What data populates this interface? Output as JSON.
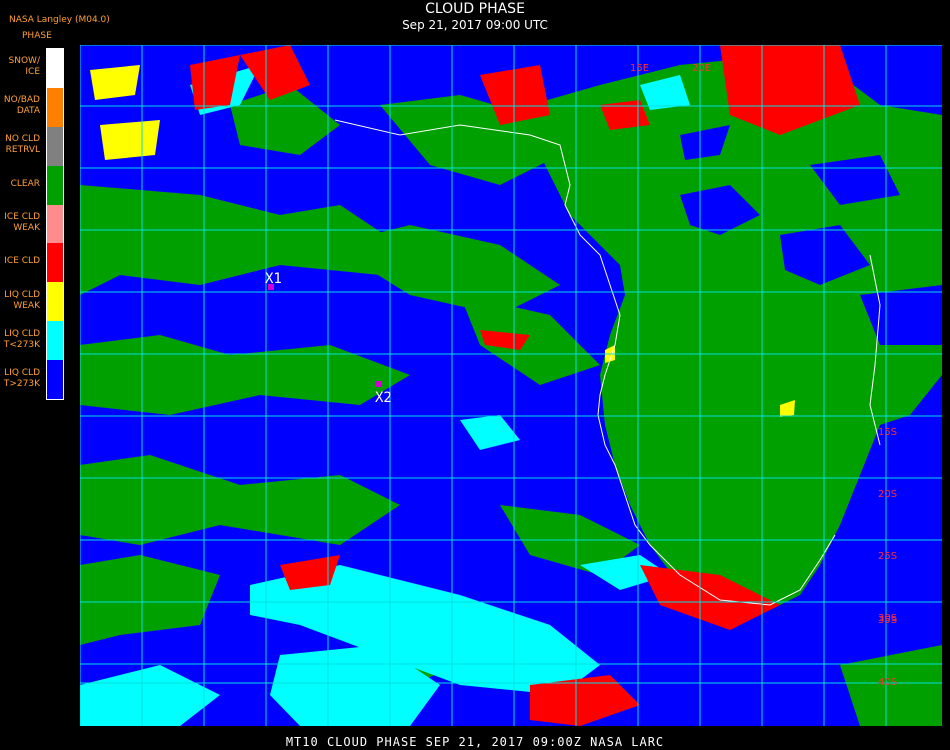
{
  "header": {
    "source": "NASA Langley (M04.0)",
    "product": "PHASE",
    "title": "CLOUD PHASE",
    "datetime": "Sep 21, 2017 09:00 UTC"
  },
  "legend": [
    {
      "label_lines": [
        "SNOW/",
        "ICE"
      ],
      "color": "#ffffff"
    },
    {
      "label_lines": [
        "NO/BAD",
        "DATA"
      ],
      "color": "#ff8000"
    },
    {
      "label_lines": [
        "NO CLD",
        "RETRVL"
      ],
      "color": "#808080"
    },
    {
      "label_lines": [
        "CLEAR"
      ],
      "color": "#00a000"
    },
    {
      "label_lines": [
        "ICE CLD",
        "WEAK"
      ],
      "color": "#ff8c8c"
    },
    {
      "label_lines": [
        "ICE CLD"
      ],
      "color": "#ff0000"
    },
    {
      "label_lines": [
        "LIQ CLD",
        "WEAK"
      ],
      "color": "#ffff00"
    },
    {
      "label_lines": [
        "LIQ CLD",
        "T<273K"
      ],
      "color": "#00ffff"
    },
    {
      "label_lines": [
        "LIQ CLD",
        "T>273K"
      ],
      "color": "#0000ff"
    }
  ],
  "map": {
    "markers": [
      {
        "label": "X1",
        "color": "#d000d0"
      },
      {
        "label": "X2",
        "color": "#d000d0"
      }
    ],
    "lat_labels": [
      "15S",
      "20S",
      "25S",
      "30S",
      "35S",
      "40S"
    ],
    "lon_labels": [
      "15E",
      "20E"
    ],
    "grid_color": "#00e0e0",
    "label_color": "#ff3030"
  },
  "footer": {
    "text": "MT10   CLOUD PHASE   SEP 21, 2017 09:00Z   NASA LARC"
  }
}
